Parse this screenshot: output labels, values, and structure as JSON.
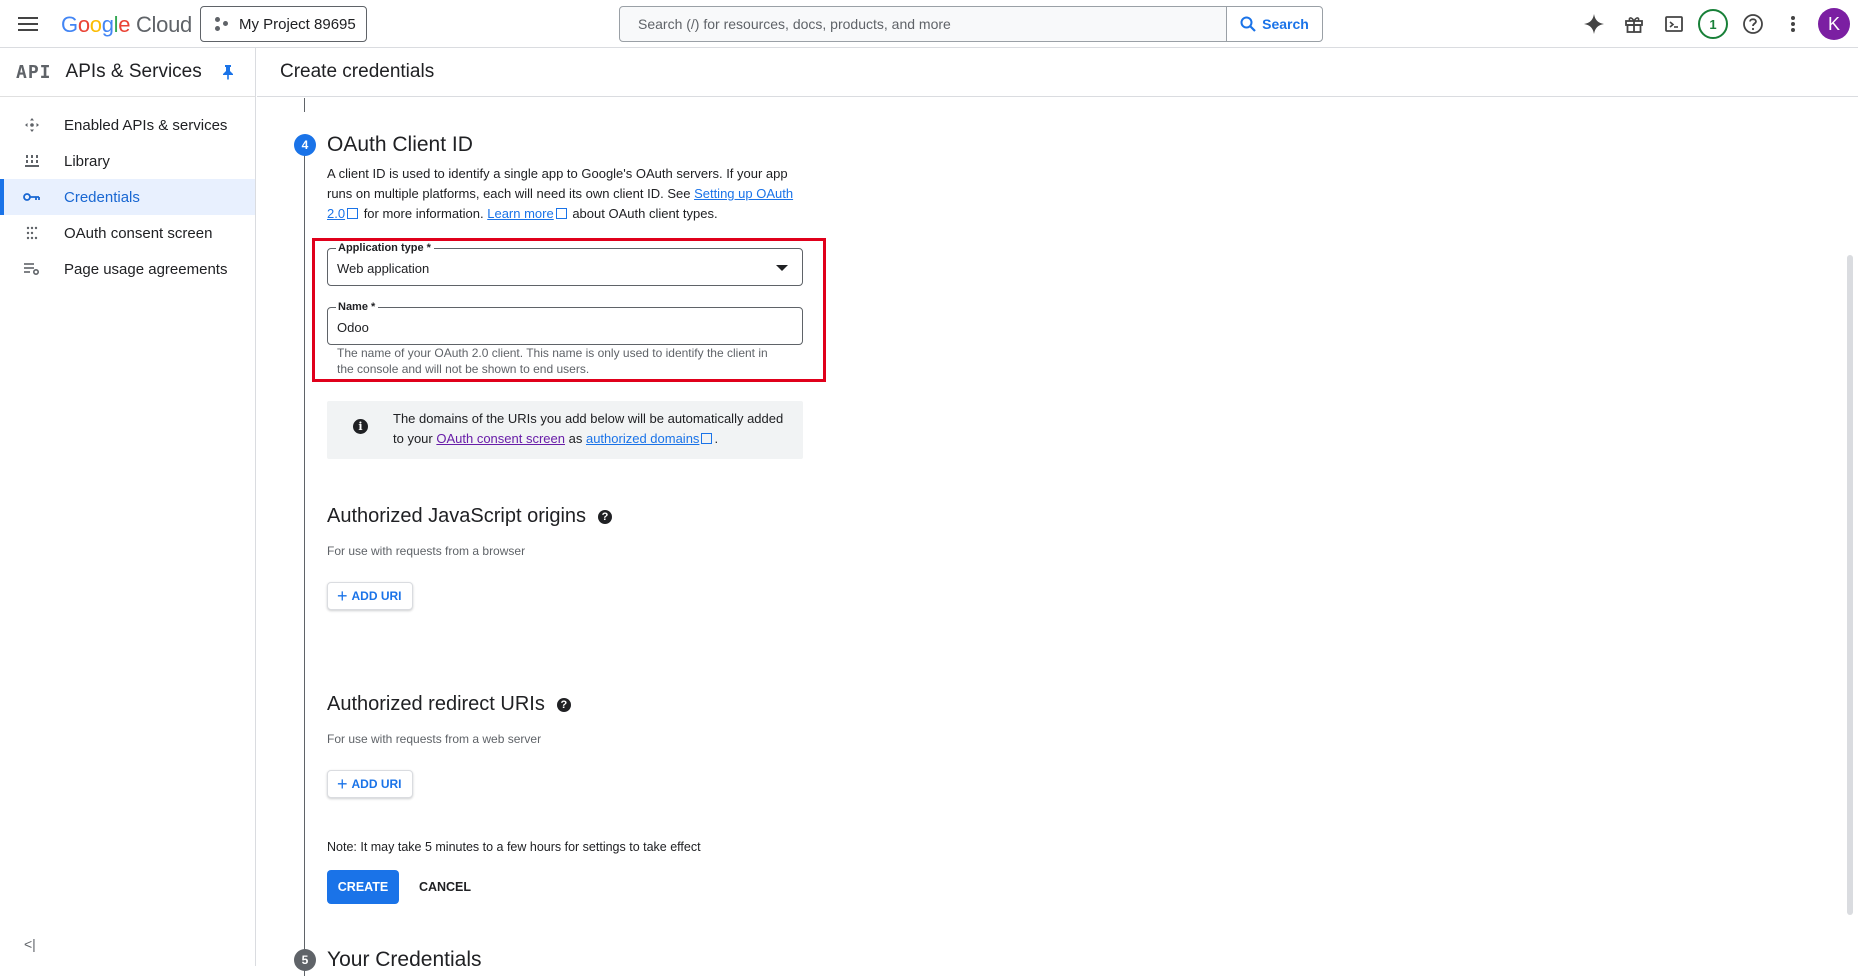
{
  "header": {
    "logo_google": "Google",
    "logo_cloud": "Cloud",
    "project": "My Project 89695",
    "search_placeholder": "Search (/) for resources, docs, products, and more",
    "search_button": "Search",
    "notification_count": "1",
    "avatar_letter": "K"
  },
  "sidebar": {
    "api_logo": "API",
    "title": "APIs & Services",
    "items": [
      {
        "label": "Enabled APIs & services",
        "icon": "diamond-arrows-icon"
      },
      {
        "label": "Library",
        "icon": "library-icon"
      },
      {
        "label": "Credentials",
        "icon": "key-icon",
        "active": true
      },
      {
        "label": "OAuth consent screen",
        "icon": "dotted-grid-icon"
      },
      {
        "label": "Page usage agreements",
        "icon": "settings-list-icon"
      }
    ],
    "collapse_label": "<|"
  },
  "page": {
    "title": "Create credentials"
  },
  "step4": {
    "number": "4",
    "title": "OAuth Client ID",
    "desc_part1": "A client ID is used to identify a single app to Google's OAuth servers. If your app runs on multiple platforms, each will need its own client ID. See ",
    "desc_link1": "Setting up OAuth 2.0",
    "desc_part2": " for more information. ",
    "desc_link2": "Learn more",
    "desc_part3": " about OAuth client types."
  },
  "form": {
    "app_type_label": "Application type *",
    "app_type_value": "Web application",
    "name_label": "Name *",
    "name_value": "Odoo",
    "name_hint": "The name of your OAuth 2.0 client. This name is only used to identify the client in the console and will not be shown to end users."
  },
  "info": {
    "part1": "The domains of the URIs you add below will be automatically added to your ",
    "link1": "OAuth consent screen",
    "part2": " as ",
    "link2": "authorized domains",
    "part3": "."
  },
  "js_origins": {
    "title": "Authorized JavaScript origins",
    "subtitle": "For use with requests from a browser",
    "add_label": "ADD URI"
  },
  "redirect_uris": {
    "title": "Authorized redirect URIs",
    "subtitle": "For use with requests from a web server",
    "add_label": "ADD URI"
  },
  "note": "Note: It may take 5 minutes to a few hours for settings to take effect",
  "actions": {
    "create": "CREATE",
    "cancel": "CANCEL"
  },
  "step5": {
    "number": "5",
    "title": "Your Credentials"
  },
  "colors": {
    "primary": "#1a73e8",
    "highlight": "#e0001b",
    "avatar": "#7b1fa2",
    "badge": "#188038"
  }
}
